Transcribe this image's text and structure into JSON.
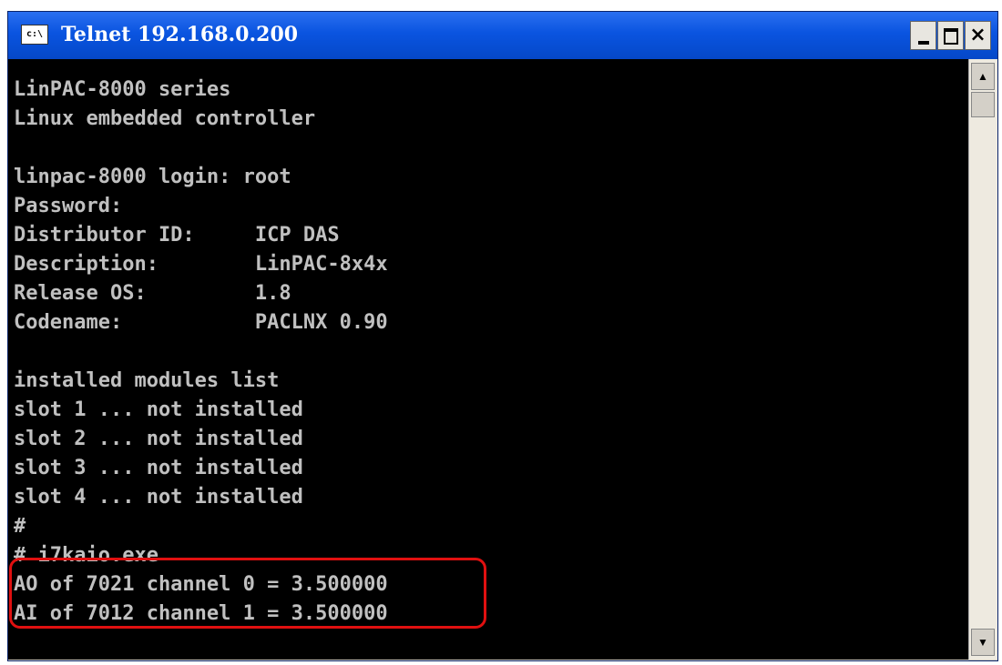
{
  "window": {
    "title": "Telnet 192.168.0.200",
    "app_icon_text": "c:\\",
    "controls": {
      "minimize_icon": "minimize-icon",
      "maximize_icon": "maximize-icon",
      "close_label": "×"
    }
  },
  "console": {
    "lines": [
      "LinPAC-8000 series",
      "Linux embedded controller",
      "",
      "linpac-8000 login: root",
      "Password:",
      "Distributor ID:     ICP DAS",
      "Description:        LinPAC-8x4x",
      "Release OS:         1.8",
      "Codename:           PACLNX 0.90",
      "",
      "installed modules list",
      "slot 1 ... not installed",
      "slot 2 ... not installed",
      "slot 3 ... not installed",
      "slot 4 ... not installed",
      "#",
      "# i7kaio.exe",
      "AO of 7021 channel 0 = 3.500000",
      "AI of 7012 channel 1 = 3.500000"
    ]
  },
  "scrollbar": {
    "up_arrow": "▲",
    "down_arrow": "▼"
  },
  "colors": {
    "titlebar": "#0a54e0",
    "console_bg": "#000000",
    "console_text": "#c0c0c0",
    "highlight": "#e01010"
  }
}
